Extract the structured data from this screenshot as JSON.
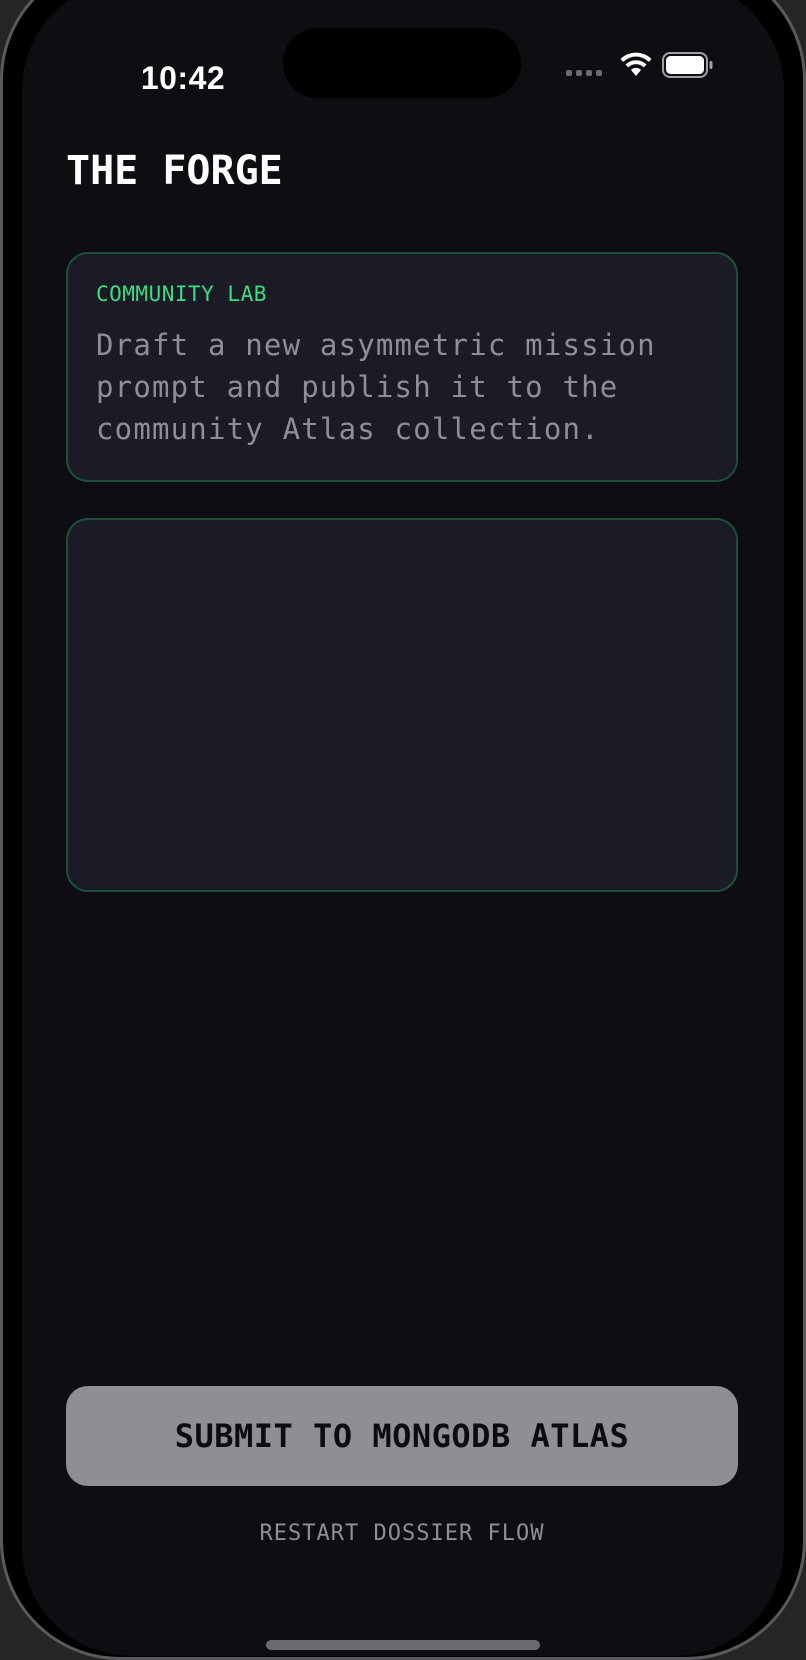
{
  "status_bar": {
    "time": "10:42",
    "wifi_icon": "wifi-icon",
    "battery_icon": "battery-icon",
    "signal_icon": "cellular-signal-icon"
  },
  "page": {
    "title": "THE FORGE"
  },
  "info_card": {
    "eyebrow": "COMMUNITY LAB",
    "description": "Draft a new asymmetric mission prompt and publish it to the community Atlas collection."
  },
  "editor": {
    "value": "",
    "placeholder": ""
  },
  "actions": {
    "submit_label": "SUBMIT TO MONGODB ATLAS",
    "restart_label": "RESTART DOSSIER FLOW"
  },
  "colors": {
    "background": "#0e0e12",
    "card": "#1b1b26",
    "card_border": "#1e4f3a",
    "accent_green": "#3ddc84",
    "button": "#8e8e94"
  }
}
